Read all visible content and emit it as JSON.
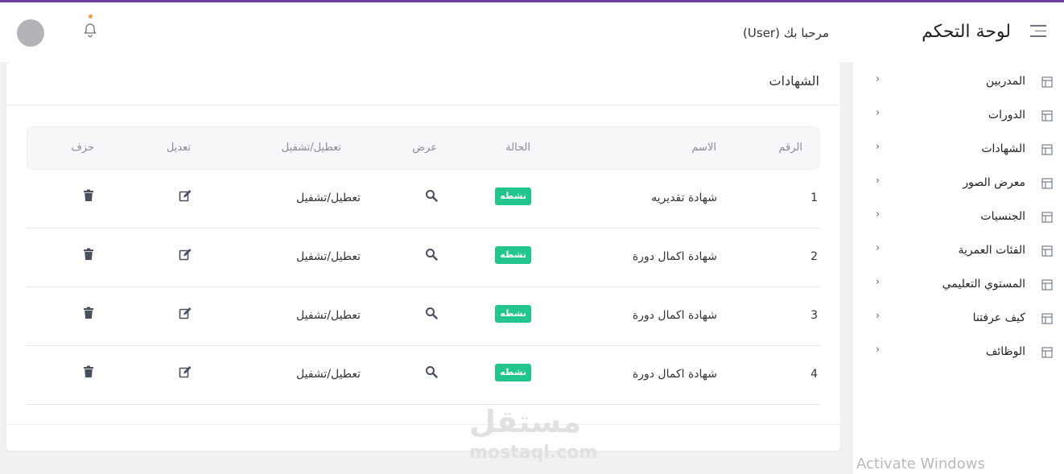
{
  "header": {
    "app_title": "لوحة التحكم",
    "welcome": "مرحبا بك (User)",
    "icons": {
      "menu": "hamburger-icon",
      "notifications": "bell-icon",
      "avatar": "user-avatar"
    }
  },
  "sidebar": {
    "items": [
      {
        "label": "المدربين",
        "icon": "table-icon"
      },
      {
        "label": "الدورات",
        "icon": "table-icon"
      },
      {
        "label": "الشهادات",
        "icon": "table-icon"
      },
      {
        "label": "معرض الصور",
        "icon": "table-icon"
      },
      {
        "label": "الجنسيات",
        "icon": "table-icon"
      },
      {
        "label": "الفئات العمرية",
        "icon": "table-icon"
      },
      {
        "label": "المستوي التعليمي",
        "icon": "table-icon"
      },
      {
        "label": "كيف عرفتنا",
        "icon": "table-icon"
      },
      {
        "label": "الوظائف",
        "icon": "table-icon"
      }
    ]
  },
  "main": {
    "card_title": "الشهادات",
    "table": {
      "headers": [
        "الرقم",
        "الاسم",
        "الحالة",
        "عرض",
        "تعطيل/تشفيل",
        "تعديل",
        "حزف"
      ],
      "rows": [
        {
          "num": "1",
          "name": "شهادة تقديريه",
          "status": "نشطه",
          "toggle": "تعطيل/تشفيل"
        },
        {
          "num": "2",
          "name": "شهادة اكمال دورة",
          "status": "نشطه",
          "toggle": "تعطيل/تشفيل"
        },
        {
          "num": "3",
          "name": "شهادة اكمال دورة",
          "status": "نشطه",
          "toggle": "تعطيل/تشفيل"
        },
        {
          "num": "4",
          "name": "شهادة اكمال دورة",
          "status": "نشطه",
          "toggle": "تعطيل/تشفيل"
        }
      ]
    }
  },
  "watermarks": {
    "logo": "مستقل",
    "site": "mostaql.com",
    "os_notice": "Activate Windows"
  },
  "colors": {
    "accent": "#6b3fa0",
    "status_active": "#22c58b",
    "icon": "#4a4f5e"
  }
}
